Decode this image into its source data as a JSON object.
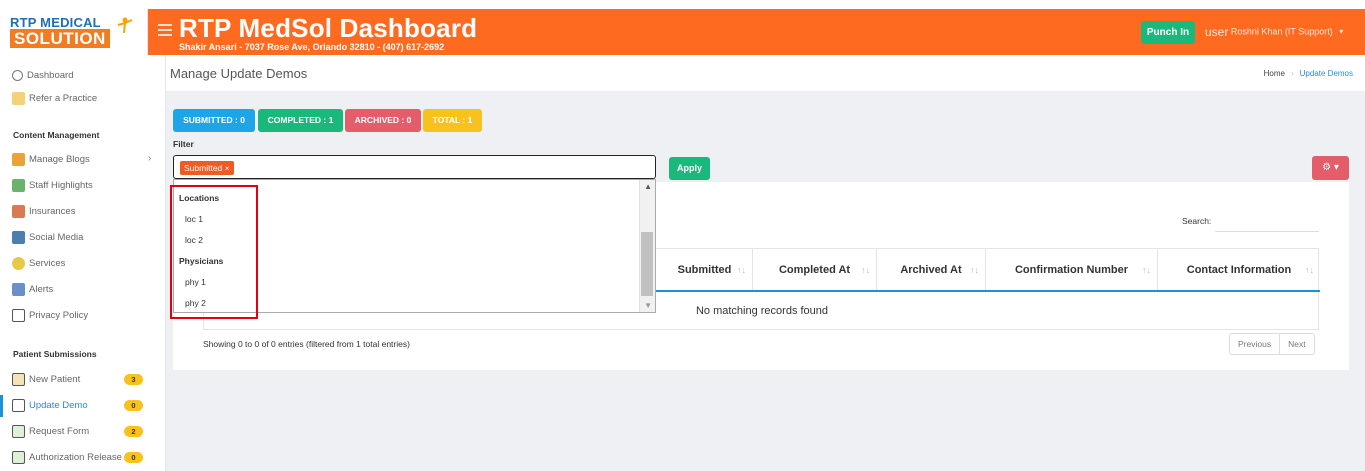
{
  "brand": {
    "line1": "RTP MEDICAL",
    "line2": "SOLUTION"
  },
  "header": {
    "title": "RTP MedSol Dashboard",
    "subtitle": "Shakir Ansari - 7037 Rose Ave, Orlando 32810 - (407) 617-2692",
    "punch_label": "Punch In",
    "user_img_alt": "user",
    "user_name": "Roshni Khan (IT Support)"
  },
  "sidebar": {
    "items": [
      {
        "label": "Dashboard"
      },
      {
        "label": "Refer a Practice"
      },
      {
        "section": "Content Management"
      },
      {
        "label": "Manage Blogs"
      },
      {
        "label": "Staff Highlights"
      },
      {
        "label": "Insurances"
      },
      {
        "label": "Social Media"
      },
      {
        "label": "Services"
      },
      {
        "label": "Alerts"
      },
      {
        "label": "Privacy Policy"
      },
      {
        "section": "Patient Submissions"
      },
      {
        "label": "New Patient",
        "badge": "3"
      },
      {
        "label": "Update Demo",
        "badge": "0",
        "active": true
      },
      {
        "label": "Request Form",
        "badge": "2"
      },
      {
        "label": "Authorization Release",
        "badge": "0"
      }
    ]
  },
  "page": {
    "title": "Manage Update Demos",
    "breadcrumb": [
      "Home",
      "Update Demos"
    ]
  },
  "stats": [
    {
      "label": "SUBMITTED : 0",
      "color": "#1ea5e8"
    },
    {
      "label": "COMPLETED : 1",
      "color": "#1bb87c"
    },
    {
      "label": "ARCHIVED : 0",
      "color": "#e35d6a"
    },
    {
      "label": "TOTAL : 1",
      "color": "#f7c21c"
    }
  ],
  "filter": {
    "label": "Filter",
    "chip": "Submitted ×",
    "apply_label": "Apply",
    "gear": "⚙ ▾",
    "dropdown": [
      {
        "group": "Locations"
      },
      {
        "option": "loc 1"
      },
      {
        "option": "loc 2"
      },
      {
        "group": "Physicians"
      },
      {
        "option": "phy 1"
      },
      {
        "option": "phy 2"
      }
    ]
  },
  "table": {
    "search_label": "Search:",
    "columns": [
      "Submitted",
      "Completed At",
      "Archived At",
      "Confirmation Number",
      "Contact Information"
    ],
    "empty_message": "No matching records found",
    "info": "Showing 0 to 0 of 0 entries (filtered from 1 total entries)",
    "prev": "Previous",
    "next": "Next"
  }
}
